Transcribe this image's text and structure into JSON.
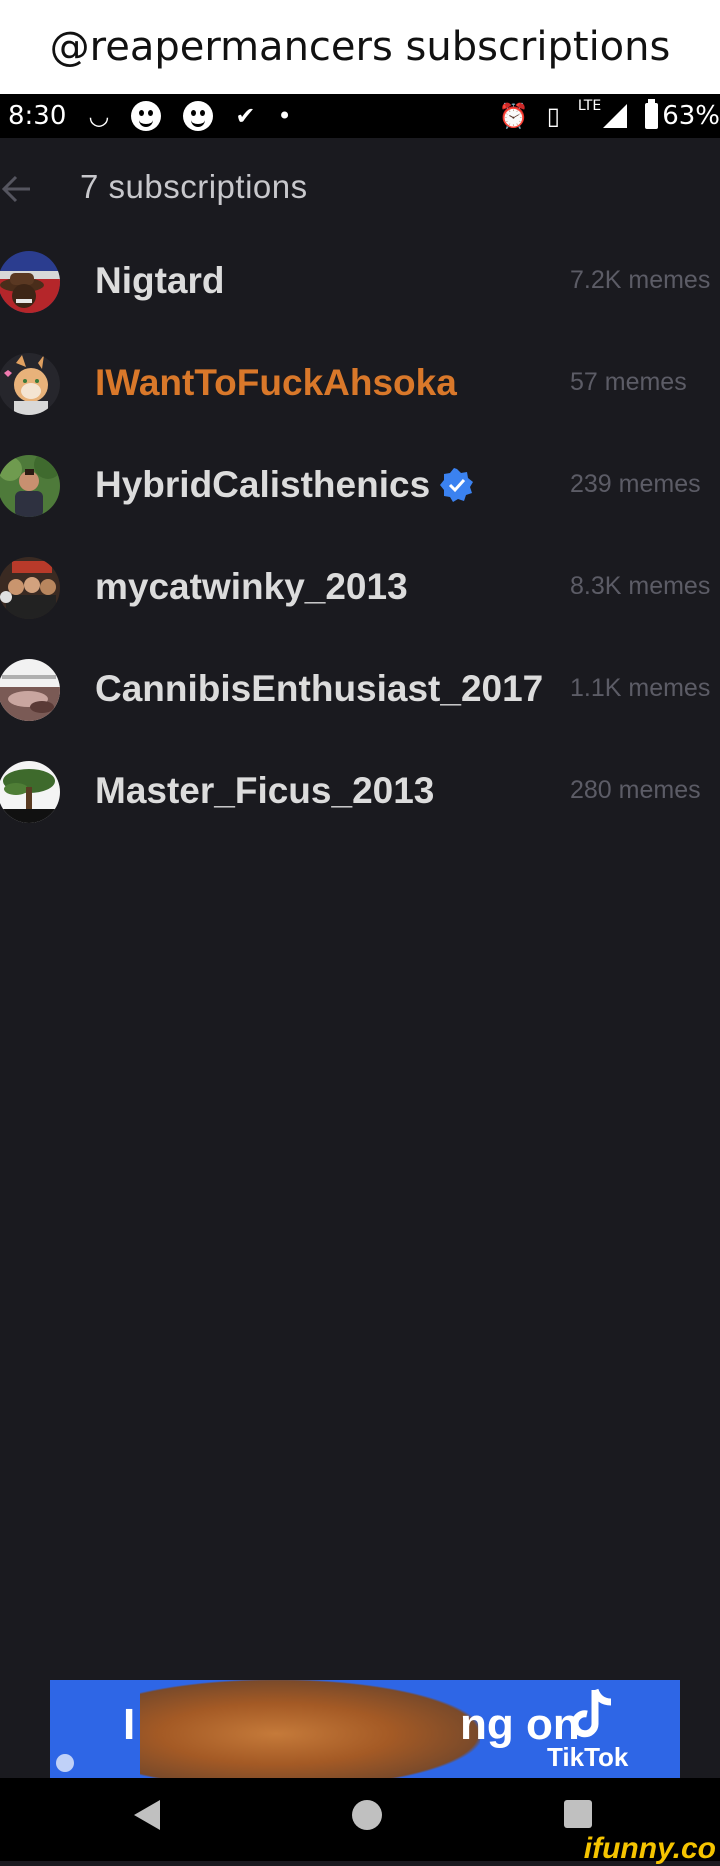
{
  "caption": "@reapermancers subscriptions",
  "status_bar": {
    "time": "8:30",
    "network": "LTE",
    "battery": "63%"
  },
  "header": {
    "title": "7 subscriptions"
  },
  "subscriptions": [
    {
      "name": "Nigtard",
      "count": "7.2K memes",
      "color": "#dcdcdc"
    },
    {
      "name": "IWantToFuckAhsoka",
      "count": "57 memes",
      "color": "#d9782a"
    },
    {
      "name": "HybridCalisthenics",
      "count": "239 memes",
      "color": "#dcdcdc",
      "verified": true
    },
    {
      "name": "mycatwinky_2013",
      "count": "8.3K memes",
      "color": "#dcdcdc"
    },
    {
      "name": "CannibisEnthusiast_2017",
      "count": "1.1K memes",
      "color": "#dcdcdc"
    },
    {
      "name": "Master_Ficus_2013",
      "count": "280 memes",
      "color": "#dcdcdc"
    }
  ],
  "ad": {
    "text_left": "I",
    "text_right": "ng on",
    "brand": "TikTok"
  },
  "watermark": "ifunny.co"
}
